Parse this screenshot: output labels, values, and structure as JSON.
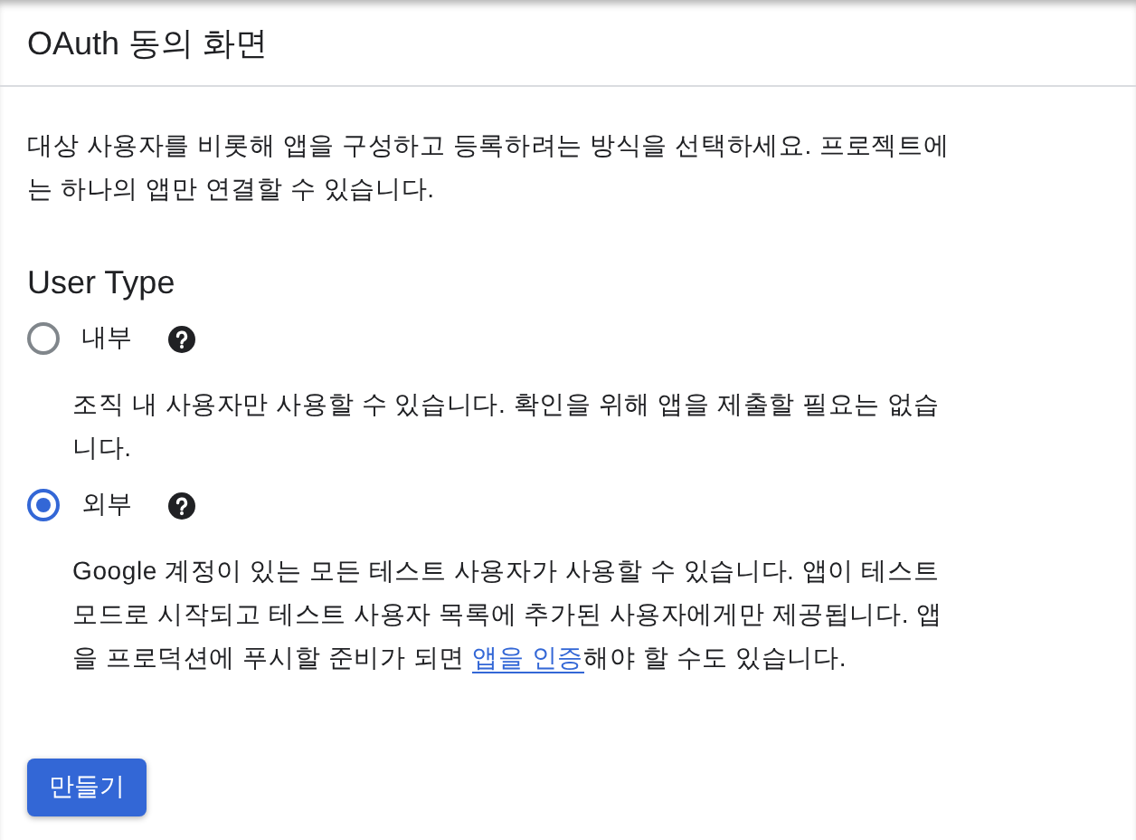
{
  "header": {
    "title": "OAuth 동의 화면"
  },
  "intro": "대상 사용자를 비롯해 앱을 구성하고 등록하려는 방식을 선택하세요. 프로젝트에는 하나의 앱만 연결할 수 있습니다.",
  "user_type": {
    "heading": "User Type",
    "options": [
      {
        "label": "내부",
        "selected": false,
        "description": "조직 내 사용자만 사용할 수 있습니다. 확인을 위해 앱을 제출할 필요는 없습니다."
      },
      {
        "label": "외부",
        "selected": true,
        "description": "Google 계정이 있는 모든 테스트 사용자가 사용할 수 있습니다. 앱이 테스트 모드로 시작되고 테스트 사용자 목록에 추가된 사용자에게만 제공됩니다. 앱을 프로덕션에 푸시할 준비가 되면 ",
        "link": "앱을 인증",
        "description_after": "해야 할 수도 있습니다."
      }
    ]
  },
  "create_button": "만들기"
}
